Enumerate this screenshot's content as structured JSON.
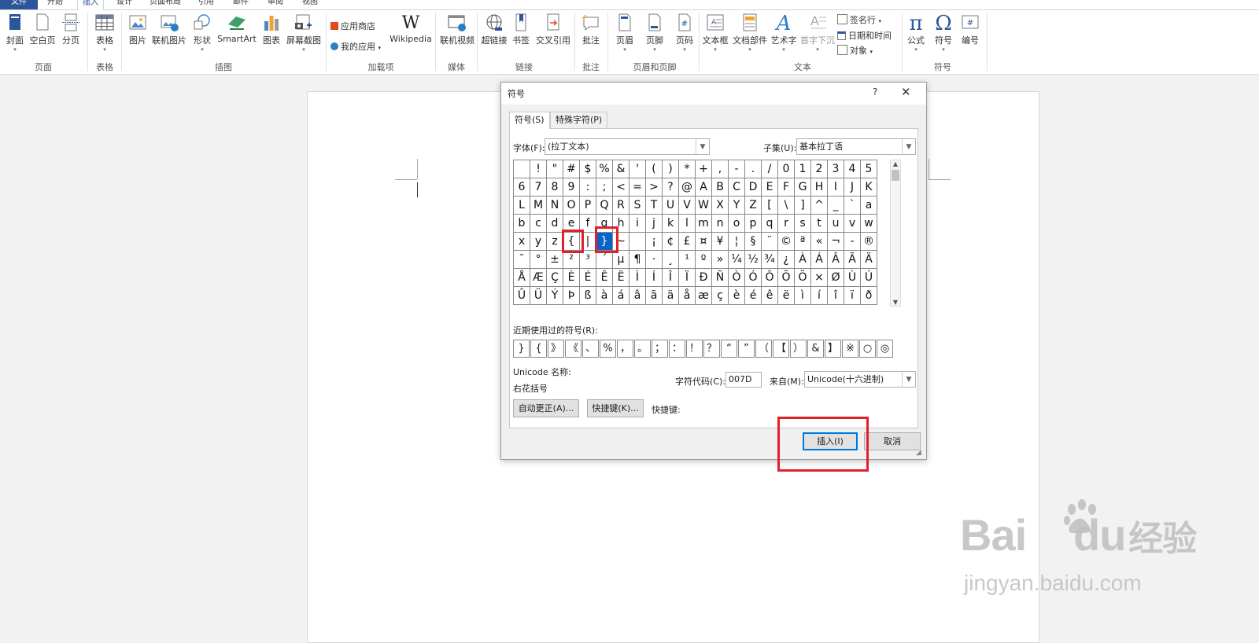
{
  "ribbon": {
    "tabs": [
      "文件",
      "开始",
      "插入",
      "设计",
      "页面布局",
      "引用",
      "邮件",
      "审阅",
      "视图"
    ],
    "active_tab": "插入",
    "groups": {
      "page": {
        "label": "页面",
        "buttons": [
          "封面",
          "空白页",
          "分页"
        ]
      },
      "table": {
        "label": "表格",
        "buttons": [
          "表格"
        ]
      },
      "illustrations": {
        "label": "插图",
        "buttons": [
          "图片",
          "联机图片",
          "形状",
          "SmartArt",
          "图表",
          "屏幕截图"
        ]
      },
      "addins": {
        "label": "加载项",
        "store": "应用商店",
        "myapps": "我的应用",
        "wiki": "Wikipedia"
      },
      "media": {
        "label": "媒体",
        "buttons": [
          "联机视频"
        ]
      },
      "links": {
        "label": "链接",
        "buttons": [
          "超链接",
          "书签",
          "交叉引用"
        ]
      },
      "comments": {
        "label": "批注",
        "buttons": [
          "批注"
        ]
      },
      "headerfooter": {
        "label": "页眉和页脚",
        "buttons": [
          "页眉",
          "页脚",
          "页码"
        ]
      },
      "text": {
        "label": "文本",
        "buttons": [
          "文本框",
          "文档部件",
          "艺术字",
          "首字下沉"
        ],
        "small": [
          "签名行",
          "日期和时间",
          "对象"
        ]
      },
      "symbols": {
        "label": "符号",
        "buttons": [
          "公式",
          "符号",
          "编号"
        ]
      }
    }
  },
  "dialog": {
    "title": "符号",
    "help": "?",
    "close": "✕",
    "tabs": [
      "符号(S)",
      "特殊字符(P)"
    ],
    "font_label": "字体(F):",
    "font_value": "(拉丁文本)",
    "subset_label": "子集(U):",
    "subset_value": "基本拉丁语",
    "symbols": [
      " ",
      "!",
      "\"",
      "#",
      "$",
      "%",
      "&",
      "'",
      "(",
      ")",
      "*",
      "+",
      ",",
      "-",
      ".",
      "/",
      "0",
      "1",
      "2",
      "3",
      "4",
      "5",
      "6",
      "7",
      "8",
      "9",
      ":",
      ";",
      "<",
      "=",
      ">",
      "?",
      "@",
      "A",
      "B",
      "C",
      "D",
      "E",
      "F",
      "G",
      "H",
      "I",
      "J",
      "K",
      "L",
      "M",
      "N",
      "O",
      "P",
      "Q",
      "R",
      "S",
      "T",
      "U",
      "V",
      "W",
      "X",
      "Y",
      "Z",
      "[",
      "\\",
      "]",
      "^",
      "_",
      "`",
      "a",
      "b",
      "c",
      "d",
      "e",
      "f",
      "g",
      "h",
      "i",
      "j",
      "k",
      "l",
      "m",
      "n",
      "o",
      "p",
      "q",
      "r",
      "s",
      "t",
      "u",
      "v",
      "w",
      "x",
      "y",
      "z",
      "{",
      "|",
      "}",
      "~",
      " ",
      "¡",
      "¢",
      "£",
      "¤",
      "¥",
      "¦",
      "§",
      "¨",
      "©",
      "ª",
      "«",
      "¬",
      "-",
      "®",
      "¯",
      "°",
      "±",
      "²",
      "³",
      "´",
      "µ",
      "¶",
      "·",
      "¸",
      "¹",
      "º",
      "»",
      "¼",
      "½",
      "¾",
      "¿",
      "À",
      "Á",
      "Â",
      "Ã",
      "Ä",
      "Å",
      "Æ",
      "Ç",
      "È",
      "É",
      "Ê",
      "Ë",
      "Ì",
      "Í",
      "Î",
      "Ï",
      "Ð",
      "Ñ",
      "Ò",
      "Ó",
      "Ô",
      "Õ",
      "Ö",
      "×",
      "Ø",
      "Ù",
      "Ú",
      "Û",
      "Ü",
      "Ý",
      "Þ",
      "ß",
      "à",
      "á",
      "â",
      "ã",
      "ä",
      "å",
      "æ",
      "ç",
      "è",
      "é",
      "ê",
      "ë",
      "ì",
      "í",
      "î",
      "ï",
      "ð"
    ],
    "selected_symbol": "}",
    "recent_label": "近期使用过的符号(R):",
    "recent": [
      "}",
      "{",
      "》",
      "《",
      "、",
      "%",
      "，",
      "。",
      "；",
      "：",
      "！",
      "？",
      "“",
      "”",
      "（",
      "【",
      "）",
      "&",
      "】",
      "※",
      "○",
      "◎"
    ],
    "unicode_name_label": "Unicode 名称:",
    "unicode_name": "右花括号",
    "charcode_label": "字符代码(C):",
    "charcode_value": "007D",
    "from_label": "来自(M):",
    "from_value": "Unicode(十六进制)",
    "autocorrect_button": "自动更正(A)...",
    "shortcut_button": "快捷键(K)...",
    "shortcut_label": "快捷键:",
    "insert_button": "插入(I)",
    "cancel_button": "取消"
  },
  "watermark": {
    "brand": "Bai",
    "brand2": "du",
    "cn": "经验",
    "url": "jingyan.baidu.com"
  },
  "colors": {
    "accent": "#2b579a",
    "selection": "#0a64c8",
    "highlight": "#e0202a"
  }
}
